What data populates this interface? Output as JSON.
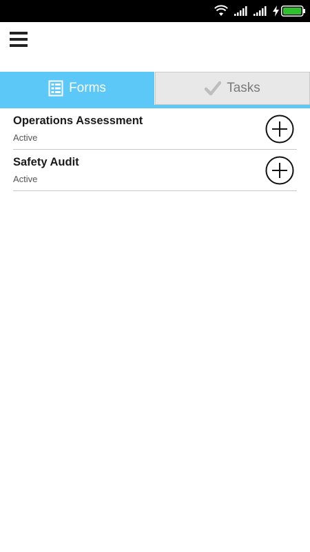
{
  "status_bar": {
    "icons": [
      "wifi-icon",
      "signal-icon",
      "signal-icon",
      "charging-icon",
      "battery-icon"
    ],
    "battery_color": "#2fbf2f"
  },
  "header": {
    "menu_icon": "hamburger-menu-icon"
  },
  "tabs": [
    {
      "label": "Forms",
      "icon": "form-icon",
      "active": true
    },
    {
      "label": "Tasks",
      "icon": "checkmark-icon",
      "active": false
    }
  ],
  "forms": [
    {
      "title": "Operations Assessment",
      "status": "Active",
      "action_icon": "add-circle-icon"
    },
    {
      "title": "Safety Audit",
      "status": "Active",
      "action_icon": "add-circle-icon"
    }
  ],
  "colors": {
    "accent": "#5bc8f7",
    "inactive_tab_bg": "#e8e8e8",
    "inactive_tab_text": "#7a7a7a"
  }
}
